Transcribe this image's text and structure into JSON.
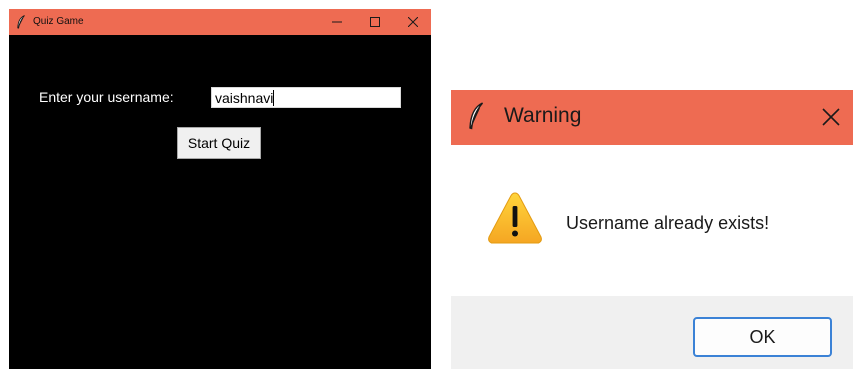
{
  "quiz_window": {
    "title": "Quiz Game",
    "titlebar_color": "#ee6b52",
    "background_color": "#000000",
    "window_controls": [
      "minimize-icon",
      "maximize-icon",
      "close-icon"
    ],
    "username_label": "Enter your username:",
    "username_value": "vaishnavi",
    "start_button_label": "Start Quiz"
  },
  "warning_dialog": {
    "title": "Warning",
    "titlebar_color": "#ee6b52",
    "icon": "warning-icon",
    "message": "Username already exists!",
    "ok_button_label": "OK",
    "ok_button_border_color": "#3b82d6"
  }
}
